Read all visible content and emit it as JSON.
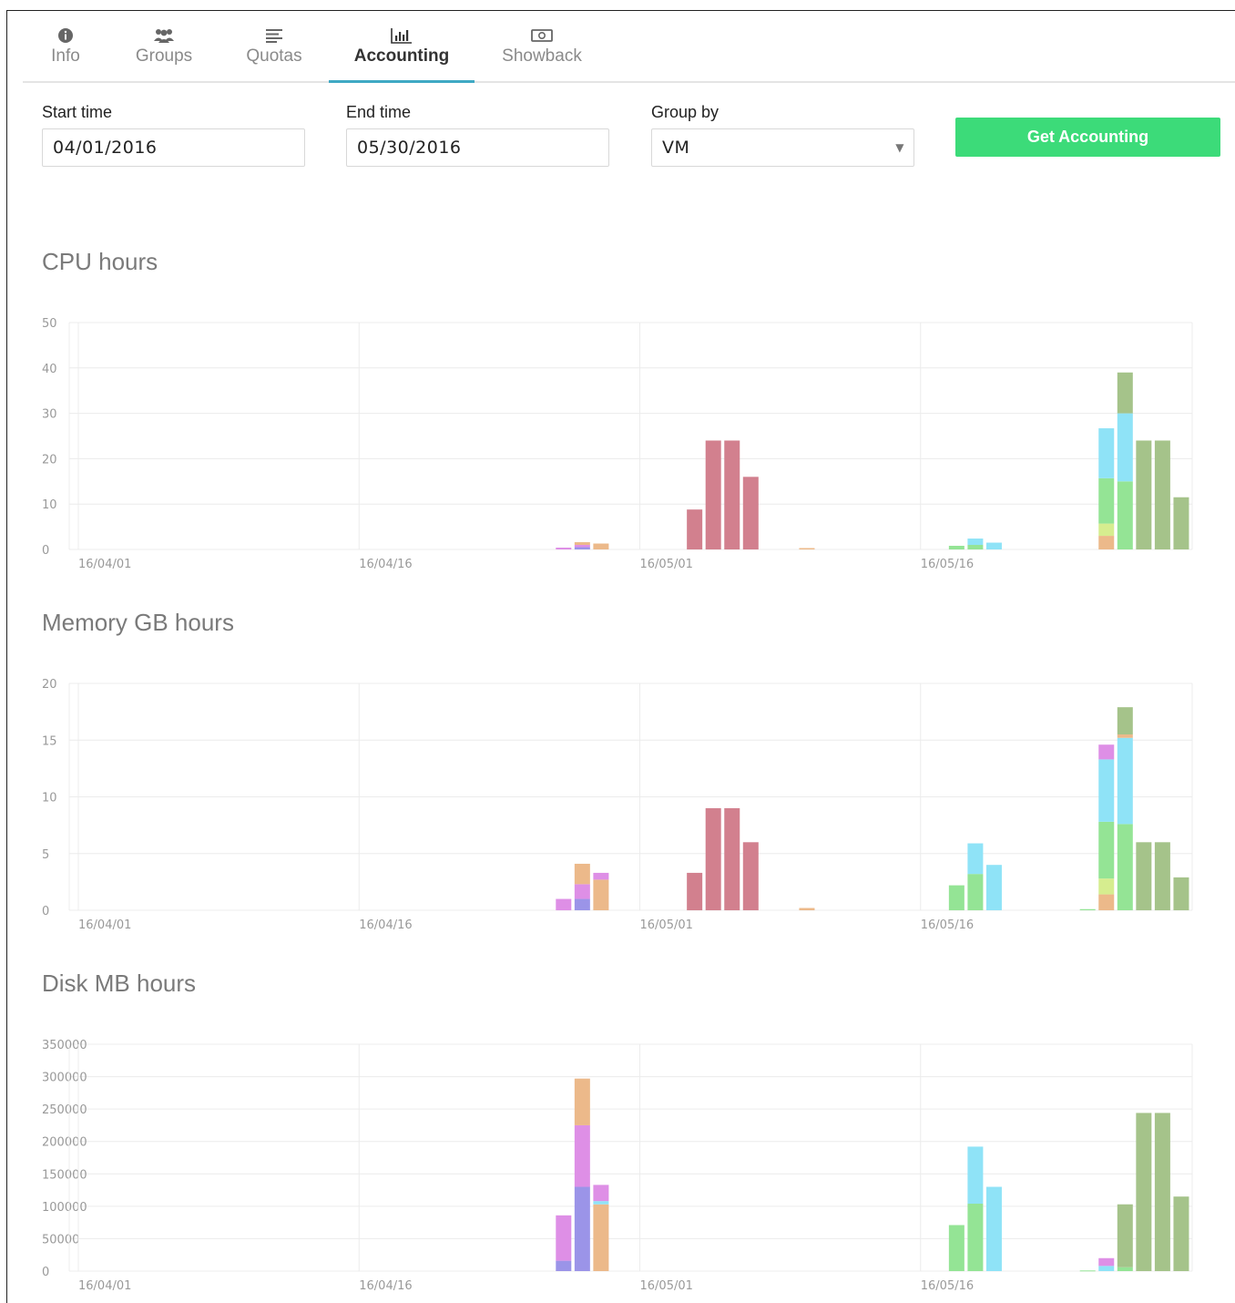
{
  "tabs": [
    {
      "label": "Info",
      "icon": "info-icon"
    },
    {
      "label": "Groups",
      "icon": "groups-icon"
    },
    {
      "label": "Quotas",
      "icon": "quotas-icon"
    },
    {
      "label": "Accounting",
      "icon": "bar-chart-icon",
      "active": true
    },
    {
      "label": "Showback",
      "icon": "money-icon"
    }
  ],
  "form": {
    "start_label": "Start time",
    "start_value": "04/01/2016",
    "end_label": "End time",
    "end_value": "05/30/2016",
    "group_label": "Group by",
    "group_value": "VM",
    "button_label": "Get Accounting"
  },
  "colors": {
    "accent": "#3cdb79",
    "tab_active": "#3fa9c4",
    "red": "#d2808e",
    "orange": "#ecb98a",
    "violet": "#de8fe6",
    "blue": "#9b94e8",
    "cyan": "#8fe3f7",
    "green": "#94e495",
    "olive": "#a5c38a",
    "lime": "#d6ed8f"
  },
  "chart_data": [
    {
      "type": "bar",
      "title": "CPU hours",
      "ylim": [
        0,
        50
      ],
      "yticks": [
        "0",
        "10",
        "20",
        "30",
        "40",
        "50"
      ],
      "xticks": [
        "16/04/01",
        "16/04/16",
        "16/05/01",
        "16/05/16"
      ],
      "stacked": true,
      "bars": [
        {
          "day": 26,
          "segments": [
            {
              "c": "violet",
              "v": 0.4
            }
          ]
        },
        {
          "day": 27,
          "segments": [
            {
              "c": "blue",
              "v": 0.5
            },
            {
              "c": "violet",
              "v": 0.5
            },
            {
              "c": "orange",
              "v": 0.6
            }
          ]
        },
        {
          "day": 28,
          "segments": [
            {
              "c": "orange",
              "v": 1.3
            }
          ]
        },
        {
          "day": 33,
          "segments": [
            {
              "c": "red",
              "v": 8.8
            }
          ]
        },
        {
          "day": 34,
          "segments": [
            {
              "c": "red",
              "v": 24
            }
          ]
        },
        {
          "day": 35,
          "segments": [
            {
              "c": "red",
              "v": 24
            }
          ]
        },
        {
          "day": 36,
          "segments": [
            {
              "c": "red",
              "v": 16
            }
          ]
        },
        {
          "day": 39,
          "segments": [
            {
              "c": "orange",
              "v": 0.3
            }
          ]
        },
        {
          "day": 47,
          "segments": [
            {
              "c": "green",
              "v": 0.8
            }
          ]
        },
        {
          "day": 48,
          "segments": [
            {
              "c": "green",
              "v": 1
            },
            {
              "c": "cyan",
              "v": 1.4
            }
          ]
        },
        {
          "day": 49,
          "segments": [
            {
              "c": "cyan",
              "v": 1.5
            }
          ]
        },
        {
          "day": 55,
          "segments": [
            {
              "c": "orange",
              "v": 3
            },
            {
              "c": "lime",
              "v": 2.7
            },
            {
              "c": "green",
              "v": 10
            },
            {
              "c": "cyan",
              "v": 11
            }
          ]
        },
        {
          "day": 56,
          "segments": [
            {
              "c": "green",
              "v": 15
            },
            {
              "c": "cyan",
              "v": 15
            },
            {
              "c": "olive",
              "v": 9
            }
          ]
        },
        {
          "day": 57,
          "segments": [
            {
              "c": "olive",
              "v": 24
            }
          ]
        },
        {
          "day": 58,
          "segments": [
            {
              "c": "olive",
              "v": 24
            }
          ]
        },
        {
          "day": 59,
          "segments": [
            {
              "c": "olive",
              "v": 11.5
            }
          ]
        }
      ]
    },
    {
      "type": "bar",
      "title": "Memory GB hours",
      "ylim": [
        0,
        20
      ],
      "yticks": [
        "0",
        "5",
        "10",
        "15",
        "20"
      ],
      "xticks": [
        "16/04/01",
        "16/04/16",
        "16/05/01",
        "16/05/16"
      ],
      "stacked": true,
      "bars": [
        {
          "day": 26,
          "segments": [
            {
              "c": "violet",
              "v": 1
            }
          ]
        },
        {
          "day": 27,
          "segments": [
            {
              "c": "blue",
              "v": 1
            },
            {
              "c": "violet",
              "v": 1.3
            },
            {
              "c": "orange",
              "v": 1.8
            }
          ]
        },
        {
          "day": 28,
          "segments": [
            {
              "c": "orange",
              "v": 2.7
            },
            {
              "c": "violet",
              "v": 0.6
            }
          ]
        },
        {
          "day": 33,
          "segments": [
            {
              "c": "red",
              "v": 3.3
            }
          ]
        },
        {
          "day": 34,
          "segments": [
            {
              "c": "red",
              "v": 9
            }
          ]
        },
        {
          "day": 35,
          "segments": [
            {
              "c": "red",
              "v": 9
            }
          ]
        },
        {
          "day": 36,
          "segments": [
            {
              "c": "red",
              "v": 6
            }
          ]
        },
        {
          "day": 39,
          "segments": [
            {
              "c": "orange",
              "v": 0.2
            }
          ]
        },
        {
          "day": 47,
          "segments": [
            {
              "c": "green",
              "v": 2.2
            }
          ]
        },
        {
          "day": 48,
          "segments": [
            {
              "c": "green",
              "v": 3.2
            },
            {
              "c": "cyan",
              "v": 2.7
            }
          ]
        },
        {
          "day": 49,
          "segments": [
            {
              "c": "cyan",
              "v": 4
            }
          ]
        },
        {
          "day": 54,
          "segments": [
            {
              "c": "green",
              "v": 0.1
            }
          ]
        },
        {
          "day": 55,
          "segments": [
            {
              "c": "orange",
              "v": 1.4
            },
            {
              "c": "lime",
              "v": 1.4
            },
            {
              "c": "green",
              "v": 5
            },
            {
              "c": "cyan",
              "v": 5.5
            },
            {
              "c": "violet",
              "v": 1.3
            }
          ]
        },
        {
          "day": 56,
          "segments": [
            {
              "c": "green",
              "v": 7.6
            },
            {
              "c": "cyan",
              "v": 7.6
            },
            {
              "c": "orange",
              "v": 0.3
            },
            {
              "c": "olive",
              "v": 2.4
            }
          ]
        },
        {
          "day": 57,
          "segments": [
            {
              "c": "olive",
              "v": 6
            }
          ]
        },
        {
          "day": 58,
          "segments": [
            {
              "c": "olive",
              "v": 6
            }
          ]
        },
        {
          "day": 59,
          "segments": [
            {
              "c": "olive",
              "v": 2.9
            }
          ]
        }
      ]
    },
    {
      "type": "bar",
      "title": "Disk MB hours",
      "ylim": [
        0,
        350000
      ],
      "yticks": [
        "0",
        "50000",
        "100000",
        "150000",
        "200000",
        "250000",
        "300000",
        "350000"
      ],
      "xticks": [
        "16/04/01",
        "16/04/16",
        "16/05/01",
        "16/05/16"
      ],
      "stacked": true,
      "bars": [
        {
          "day": 26,
          "segments": [
            {
              "c": "blue",
              "v": 16000
            },
            {
              "c": "violet",
              "v": 70000
            }
          ]
        },
        {
          "day": 27,
          "segments": [
            {
              "c": "blue",
              "v": 130000
            },
            {
              "c": "violet",
              "v": 95000
            },
            {
              "c": "orange",
              "v": 72000
            }
          ]
        },
        {
          "day": 28,
          "segments": [
            {
              "c": "orange",
              "v": 103000
            },
            {
              "c": "cyan",
              "v": 5000
            },
            {
              "c": "violet",
              "v": 25000
            }
          ]
        },
        {
          "day": 47,
          "segments": [
            {
              "c": "green",
              "v": 71000
            }
          ]
        },
        {
          "day": 48,
          "segments": [
            {
              "c": "green",
              "v": 104000
            },
            {
              "c": "cyan",
              "v": 88000
            }
          ]
        },
        {
          "day": 49,
          "segments": [
            {
              "c": "cyan",
              "v": 130000
            }
          ]
        },
        {
          "day": 54,
          "segments": [
            {
              "c": "green",
              "v": 1000
            }
          ]
        },
        {
          "day": 55,
          "segments": [
            {
              "c": "cyan",
              "v": 8000
            },
            {
              "c": "violet",
              "v": 12000
            }
          ]
        },
        {
          "day": 56,
          "segments": [
            {
              "c": "green",
              "v": 6000
            },
            {
              "c": "olive",
              "v": 97000
            }
          ]
        },
        {
          "day": 57,
          "segments": [
            {
              "c": "olive",
              "v": 244000
            }
          ]
        },
        {
          "day": 58,
          "segments": [
            {
              "c": "olive",
              "v": 244000
            }
          ]
        },
        {
          "day": 59,
          "segments": [
            {
              "c": "olive",
              "v": 115000
            }
          ]
        }
      ]
    }
  ]
}
